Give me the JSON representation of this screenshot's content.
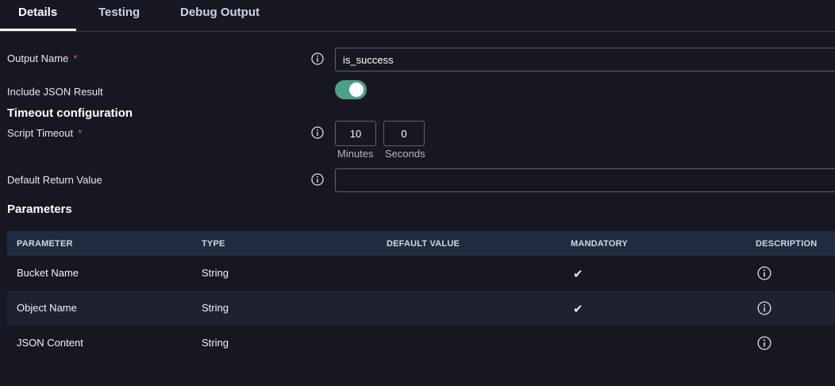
{
  "tabs": [
    {
      "label": "Details",
      "active": true
    },
    {
      "label": "Testing",
      "active": false
    },
    {
      "label": "Debug Output",
      "active": false
    }
  ],
  "form": {
    "output_name": {
      "label": "Output Name",
      "required_mark": "*",
      "value": "is_success"
    },
    "include_json": {
      "label": "Include JSON Result",
      "enabled": true
    },
    "timeout_section": "Timeout configuration",
    "script_timeout": {
      "label": "Script Timeout",
      "required_mark": "*",
      "minutes_value": "10",
      "minutes_label": "Minutes",
      "seconds_value": "0",
      "seconds_label": "Seconds"
    },
    "default_return": {
      "label": "Default Return Value",
      "value": ""
    }
  },
  "parameters": {
    "title": "Parameters",
    "columns": [
      "PARAMETER",
      "TYPE",
      "DEFAULT VALUE",
      "MANDATORY",
      "DESCRIPTION"
    ],
    "rows": [
      {
        "parameter": "Bucket Name",
        "type": "String",
        "default": "",
        "mandatory": "✔",
        "description_icon": "info-icon"
      },
      {
        "parameter": "Object Name",
        "type": "String",
        "default": "",
        "mandatory": "✔",
        "description_icon": "info-icon"
      },
      {
        "parameter": "JSON Content",
        "type": "String",
        "default": "",
        "mandatory": "",
        "description_icon": "info-icon"
      }
    ]
  },
  "colors": {
    "accent_toggle": "#4e9f8a",
    "required": "#e05a5a",
    "header_bg": "#212b40",
    "page_bg": "#171722"
  }
}
